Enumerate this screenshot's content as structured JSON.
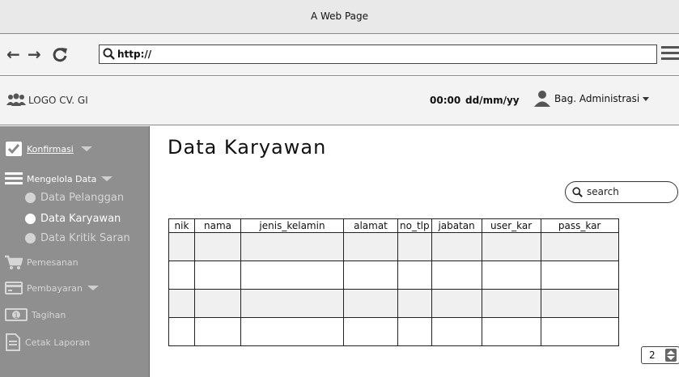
{
  "window": {
    "title": "A Web Page"
  },
  "browser": {
    "url": "http://"
  },
  "header": {
    "logo_text": "LOGO CV. GI",
    "time": "00:00",
    "date": "dd/mm/yy",
    "user": "Bag. Administrasi"
  },
  "sidebar": {
    "items": [
      {
        "label": "Konfirmasi"
      },
      {
        "label": "Mengelola Data"
      },
      {
        "label": "Data Pelanggan"
      },
      {
        "label": "Data Karyawan"
      },
      {
        "label": "Data Kritik Saran"
      },
      {
        "label": "Pemesanan"
      },
      {
        "label": "Pembayaran"
      },
      {
        "label": "Tagihan"
      },
      {
        "label": "Cetak Laporan"
      }
    ]
  },
  "main": {
    "title": "Data Karyawan",
    "search_placeholder": "search",
    "table": {
      "columns": [
        "nik",
        "nama",
        "jenis_kelamin",
        "alamat",
        "no_tlp",
        "jabatan",
        "user_kar",
        "pass_kar"
      ],
      "rows": [
        [
          "",
          "",
          "",
          "",
          "",
          "",
          "",
          ""
        ],
        [
          "",
          "",
          "",
          "",
          "",
          "",
          "",
          ""
        ],
        [
          "",
          "",
          "",
          "",
          "",
          "",
          "",
          ""
        ],
        [
          "",
          "",
          "",
          "",
          "",
          "",
          "",
          ""
        ]
      ]
    },
    "page": "2"
  }
}
